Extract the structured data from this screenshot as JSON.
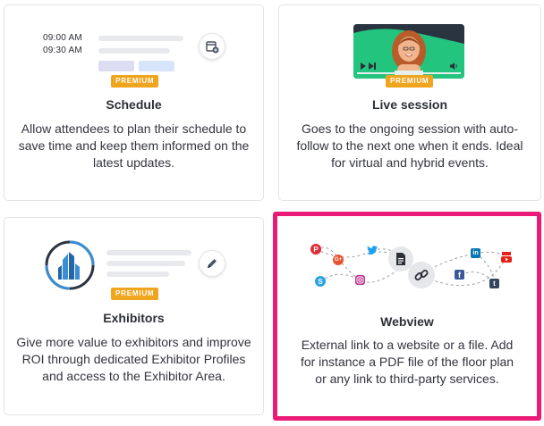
{
  "cards": {
    "schedule": {
      "title": "Schedule",
      "badge": "PREMIUM",
      "times": [
        "09:00 AM",
        "09:30 AM"
      ],
      "description": "Allow attendees to plan their schedule to save time and keep them informed on the latest updates.",
      "icon": "calendar-add-icon"
    },
    "live_session": {
      "title": "Live session",
      "badge": "PREMIUM",
      "description": "Goes to the ongoing session with auto-follow to the next one when it ends. Ideal for virtual and hybrid events.",
      "icons": [
        "play-icon",
        "skip-icon",
        "volume-icon"
      ]
    },
    "exhibitors": {
      "title": "Exhibitors",
      "badge": "PREMIUM",
      "description": "Give more value to exhibitors and improve ROI through dedicated Exhibitor Profiles and access to the Exhibitor Area.",
      "icon": "pencil-icon"
    },
    "webview": {
      "title": "Webview",
      "description": "External link to a website or a file. Add for instance a PDF file of the floor plan or any link to third-party services.",
      "selected": true,
      "icons": [
        "pinterest-icon",
        "google-plus-icon",
        "twitter-icon",
        "skype-icon",
        "instagram-icon",
        "document-icon",
        "link-icon",
        "facebook-icon",
        "linkedin-icon",
        "youtube-icon",
        "tumblr-icon"
      ]
    }
  },
  "colors": {
    "selected_border": "#ea1a77",
    "premium_badge": "#f0a51e",
    "live_session_bg": "#23c47e",
    "placeholder_blue": "#d7e5fa",
    "placeholder_purple": "#dcdcf2",
    "building_blue": "#3a8ed1"
  }
}
